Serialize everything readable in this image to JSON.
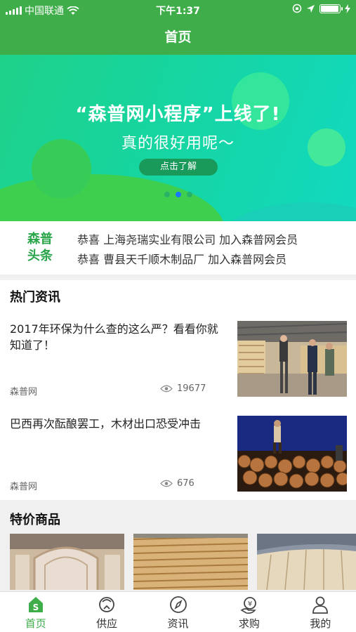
{
  "status": {
    "carrier": "中国联通",
    "time": "下午1:37",
    "battery_level": 0.95
  },
  "nav": {
    "title": "首页"
  },
  "banner": {
    "headline": "“森普网小程序”上线了!",
    "subline": "真的很好用呢～",
    "cta": "点击了解",
    "page_count": 3,
    "active_page": 2
  },
  "ticker": {
    "logo_line1": "森普",
    "logo_line2": "头条",
    "items": [
      {
        "text": "恭喜  上海尧瑞实业有限公司 加入森普网会员"
      },
      {
        "text": "恭喜  曹县天千顺木制品厂 加入森普网会员"
      }
    ]
  },
  "hot_news": {
    "title": "热门资讯",
    "articles": [
      {
        "title": "2017年环保为什么查的这么严？看看你就知道了！",
        "source": "森普网",
        "views": "19677"
      },
      {
        "title": "巴西再次酝酿罢工，木材出口恐受冲击",
        "source": "森普网",
        "views": "676"
      }
    ]
  },
  "specials": {
    "title": "特价商品"
  },
  "tabs": [
    {
      "label": "首页",
      "icon": "home-icon",
      "active": true
    },
    {
      "label": "供应",
      "icon": "supply-icon",
      "active": false
    },
    {
      "label": "资讯",
      "icon": "compass-icon",
      "active": false
    },
    {
      "label": "求购",
      "icon": "purchase-icon",
      "active": false
    },
    {
      "label": "我的",
      "icon": "profile-icon",
      "active": false
    }
  ],
  "colors": {
    "brand_green": "#3fae4a",
    "active_dot": "#1976ff"
  }
}
